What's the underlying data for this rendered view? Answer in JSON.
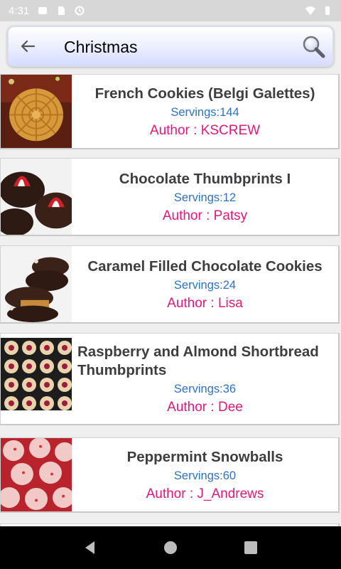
{
  "status_bar": {
    "time": "4:31",
    "icons": [
      "notification-icon",
      "sd-card-icon",
      "sync-icon",
      "wifi-icon",
      "battery-icon"
    ]
  },
  "search": {
    "value": "Christmas",
    "back_icon": "back-arrow-icon",
    "search_icon": "magnifier-icon"
  },
  "recipes": [
    {
      "title": "French Cookies (Belgi Galettes)",
      "servings": "Servings:144",
      "author": "Author : KSCREW"
    },
    {
      "title": "Chocolate Thumbprints I",
      "servings": "Servings:12",
      "author": "Author : Patsy"
    },
    {
      "title": "Caramel Filled Chocolate Cookies",
      "servings": "Servings:24",
      "author": "Author : Lisa"
    },
    {
      "title": "Raspberry and Almond Shortbread Thumbprints",
      "servings": "Servings:36",
      "author": "Author : Dee"
    },
    {
      "title": "Peppermint Snowballs",
      "servings": "Servings:60",
      "author": "Author : J_Andrews"
    }
  ],
  "colors": {
    "servings": "#2a72c9",
    "author": "#e8167a",
    "title": "#3e3e3e"
  },
  "nav": {
    "icons": [
      "nav-back-icon",
      "nav-home-icon",
      "nav-recents-icon"
    ]
  }
}
